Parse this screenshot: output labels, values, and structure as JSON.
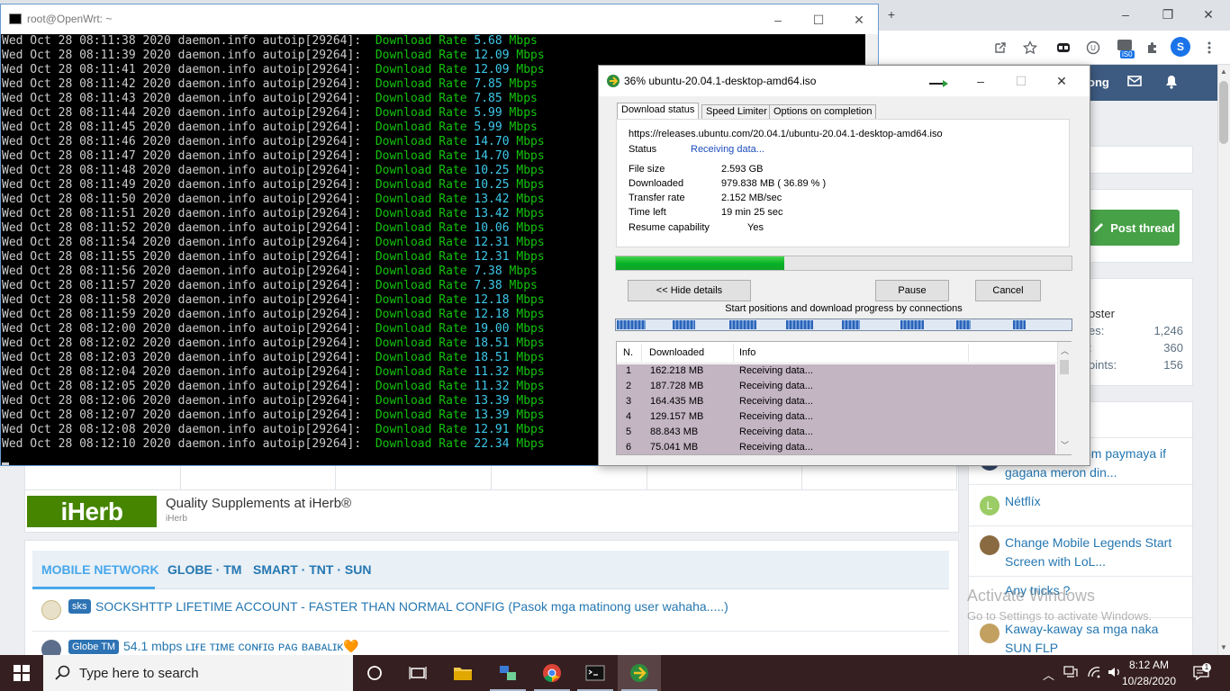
{
  "browser": {
    "controls": {
      "new_tab": "+",
      "minimize": "–",
      "restore": "❐",
      "close": "✕"
    },
    "profile_initial": "S",
    "extension_badge": "iS0"
  },
  "forum": {
    "nav_partial": "ong",
    "post_thread_label": "Post thread",
    "stats": {
      "partial_label": "oster",
      "rows": [
        {
          "label": "es:",
          "value": "1,246"
        },
        {
          "label": ":",
          "value": "360"
        },
        {
          "label": "oints:",
          "value": "156"
        }
      ]
    },
    "ad": {
      "logo_text": "iHerb",
      "title": "Quality Supplements at iHerb®",
      "subtitle": "iHerb"
    },
    "tabs": [
      "MOBILE NETWORK",
      "GLOBE · TM",
      "SMART · TNT · SUN"
    ],
    "threads": [
      {
        "prefix": "sks",
        "prefix_color": "#2d73b4",
        "title": "SOCKSHTTP LIFETIME ACCOUNT - FASTER THAN NORMAL CONFIG (Pasok mga matinong user wahaha.....)"
      },
      {
        "prefix": "Globe TM",
        "prefix_color": "#2d73b4",
        "title": "54.1 mbps ʟɪғᴇ ᴛɪᴍᴇ ᴄᴏɴғɪɢ ᴘᴀɢ ʙᴀʙᴀʟɪᴋ🧡"
      }
    ],
    "latest": [
      {
        "title": "om paymaya if gagana meron din..."
      },
      {
        "avatar_letter": "L",
        "title": "Nétflíx"
      },
      {
        "title": "Change Mobile Legends Start Screen with LoL..."
      },
      {
        "title": "Any tricks ?"
      },
      {
        "title": "Kaway-kaway sa mga naka SUN FLP"
      }
    ],
    "watermark": {
      "line1": "Activate Windows",
      "line2": "Go to Settings to activate Windows."
    }
  },
  "terminal": {
    "title": "root@OpenWrt: ~",
    "controls": {
      "minimize": "–",
      "maximize": "☐",
      "close": "✕"
    },
    "lines": [
      {
        "ts": "Wed Oct 28 08:11:38 2020",
        "src": "daemon.info autoip[29264]:",
        "label": "Download Rate",
        "rate": "5.68",
        "unit": "Mbps"
      },
      {
        "ts": "Wed Oct 28 08:11:39 2020",
        "src": "daemon.info autoip[29264]:",
        "label": "Download Rate",
        "rate": "12.09",
        "unit": "Mbps"
      },
      {
        "ts": "Wed Oct 28 08:11:41 2020",
        "src": "daemon.info autoip[29264]:",
        "label": "Download Rate",
        "rate": "12.09",
        "unit": "Mbps"
      },
      {
        "ts": "Wed Oct 28 08:11:42 2020",
        "src": "daemon.info autoip[29264]:",
        "label": "Download Rate",
        "rate": "7.85",
        "unit": "Mbps"
      },
      {
        "ts": "Wed Oct 28 08:11:43 2020",
        "src": "daemon.info autoip[29264]:",
        "label": "Download Rate",
        "rate": "7.85",
        "unit": "Mbps"
      },
      {
        "ts": "Wed Oct 28 08:11:44 2020",
        "src": "daemon.info autoip[29264]:",
        "label": "Download Rate",
        "rate": "5.99",
        "unit": "Mbps"
      },
      {
        "ts": "Wed Oct 28 08:11:45 2020",
        "src": "daemon.info autoip[29264]:",
        "label": "Download Rate",
        "rate": "5.99",
        "unit": "Mbps"
      },
      {
        "ts": "Wed Oct 28 08:11:46 2020",
        "src": "daemon.info autoip[29264]:",
        "label": "Download Rate",
        "rate": "14.70",
        "unit": "Mbps"
      },
      {
        "ts": "Wed Oct 28 08:11:47 2020",
        "src": "daemon.info autoip[29264]:",
        "label": "Download Rate",
        "rate": "14.70",
        "unit": "Mbps"
      },
      {
        "ts": "Wed Oct 28 08:11:48 2020",
        "src": "daemon.info autoip[29264]:",
        "label": "Download Rate",
        "rate": "10.25",
        "unit": "Mbps"
      },
      {
        "ts": "Wed Oct 28 08:11:49 2020",
        "src": "daemon.info autoip[29264]:",
        "label": "Download Rate",
        "rate": "10.25",
        "unit": "Mbps"
      },
      {
        "ts": "Wed Oct 28 08:11:50 2020",
        "src": "daemon.info autoip[29264]:",
        "label": "Download Rate",
        "rate": "13.42",
        "unit": "Mbps"
      },
      {
        "ts": "Wed Oct 28 08:11:51 2020",
        "src": "daemon.info autoip[29264]:",
        "label": "Download Rate",
        "rate": "13.42",
        "unit": "Mbps"
      },
      {
        "ts": "Wed Oct 28 08:11:52 2020",
        "src": "daemon.info autoip[29264]:",
        "label": "Download Rate",
        "rate": "10.06",
        "unit": "Mbps"
      },
      {
        "ts": "Wed Oct 28 08:11:54 2020",
        "src": "daemon.info autoip[29264]:",
        "label": "Download Rate",
        "rate": "12.31",
        "unit": "Mbps"
      },
      {
        "ts": "Wed Oct 28 08:11:55 2020",
        "src": "daemon.info autoip[29264]:",
        "label": "Download Rate",
        "rate": "12.31",
        "unit": "Mbps"
      },
      {
        "ts": "Wed Oct 28 08:11:56 2020",
        "src": "daemon.info autoip[29264]:",
        "label": "Download Rate",
        "rate": "7.38",
        "unit": "Mbps"
      },
      {
        "ts": "Wed Oct 28 08:11:57 2020",
        "src": "daemon.info autoip[29264]:",
        "label": "Download Rate",
        "rate": "7.38",
        "unit": "Mbps"
      },
      {
        "ts": "Wed Oct 28 08:11:58 2020",
        "src": "daemon.info autoip[29264]:",
        "label": "Download Rate",
        "rate": "12.18",
        "unit": "Mbps"
      },
      {
        "ts": "Wed Oct 28 08:11:59 2020",
        "src": "daemon.info autoip[29264]:",
        "label": "Download Rate",
        "rate": "12.18",
        "unit": "Mbps"
      },
      {
        "ts": "Wed Oct 28 08:12:00 2020",
        "src": "daemon.info autoip[29264]:",
        "label": "Download Rate",
        "rate": "19.00",
        "unit": "Mbps"
      },
      {
        "ts": "Wed Oct 28 08:12:02 2020",
        "src": "daemon.info autoip[29264]:",
        "label": "Download Rate",
        "rate": "18.51",
        "unit": "Mbps"
      },
      {
        "ts": "Wed Oct 28 08:12:03 2020",
        "src": "daemon.info autoip[29264]:",
        "label": "Download Rate",
        "rate": "18.51",
        "unit": "Mbps"
      },
      {
        "ts": "Wed Oct 28 08:12:04 2020",
        "src": "daemon.info autoip[29264]:",
        "label": "Download Rate",
        "rate": "11.32",
        "unit": "Mbps"
      },
      {
        "ts": "Wed Oct 28 08:12:05 2020",
        "src": "daemon.info autoip[29264]:",
        "label": "Download Rate",
        "rate": "11.32",
        "unit": "Mbps"
      },
      {
        "ts": "Wed Oct 28 08:12:06 2020",
        "src": "daemon.info autoip[29264]:",
        "label": "Download Rate",
        "rate": "13.39",
        "unit": "Mbps"
      },
      {
        "ts": "Wed Oct 28 08:12:07 2020",
        "src": "daemon.info autoip[29264]:",
        "label": "Download Rate",
        "rate": "13.39",
        "unit": "Mbps"
      },
      {
        "ts": "Wed Oct 28 08:12:08 2020",
        "src": "daemon.info autoip[29264]:",
        "label": "Download Rate",
        "rate": "12.91",
        "unit": "Mbps"
      },
      {
        "ts": "Wed Oct 28 08:12:10 2020",
        "src": "daemon.info autoip[29264]:",
        "label": "Download Rate",
        "rate": "22.34",
        "unit": "Mbps"
      }
    ]
  },
  "idm": {
    "title": "36% ubuntu-20.04.1-desktop-amd64.iso",
    "controls": {
      "minimize": "–",
      "maximize": "☐",
      "close": "✕"
    },
    "tabs": [
      "Download status",
      "Speed Limiter",
      "Options on completion"
    ],
    "url": "https://releases.ubuntu.com/20.04.1/ubuntu-20.04.1-desktop-amd64.iso",
    "status_label": "Status",
    "status_value": "Receiving data...",
    "fields": [
      {
        "label": "File size",
        "value": "2.593  GB"
      },
      {
        "label": "Downloaded",
        "value": "979.838  MB  ( 36.89 % )"
      },
      {
        "label": "Transfer rate",
        "value": "2.152  MB/sec"
      },
      {
        "label": "Time left",
        "value": "19 min 25 sec"
      },
      {
        "label": "Resume capability",
        "value": "Yes"
      }
    ],
    "progress_fraction": 0.3689,
    "buttons": {
      "hide_details": "<< Hide details",
      "pause": "Pause",
      "cancel": "Cancel"
    },
    "connections_caption": "Start positions and download progress by connections",
    "table_headers": [
      "N.",
      "Downloaded",
      "Info"
    ],
    "connections": [
      {
        "n": "1",
        "downloaded": "162.218  MB",
        "info": "Receiving data..."
      },
      {
        "n": "2",
        "downloaded": "187.728  MB",
        "info": "Receiving data..."
      },
      {
        "n": "3",
        "downloaded": "164.435  MB",
        "info": "Receiving data..."
      },
      {
        "n": "4",
        "downloaded": "129.157  MB",
        "info": "Receiving data..."
      },
      {
        "n": "5",
        "downloaded": "88.843  MB",
        "info": "Receiving data..."
      },
      {
        "n": "6",
        "downloaded": "75.041  MB",
        "info": "Receiving data..."
      }
    ]
  },
  "taskbar": {
    "search_placeholder": "Type here to search",
    "time": "8:12 AM",
    "date": "10/28/2020"
  }
}
